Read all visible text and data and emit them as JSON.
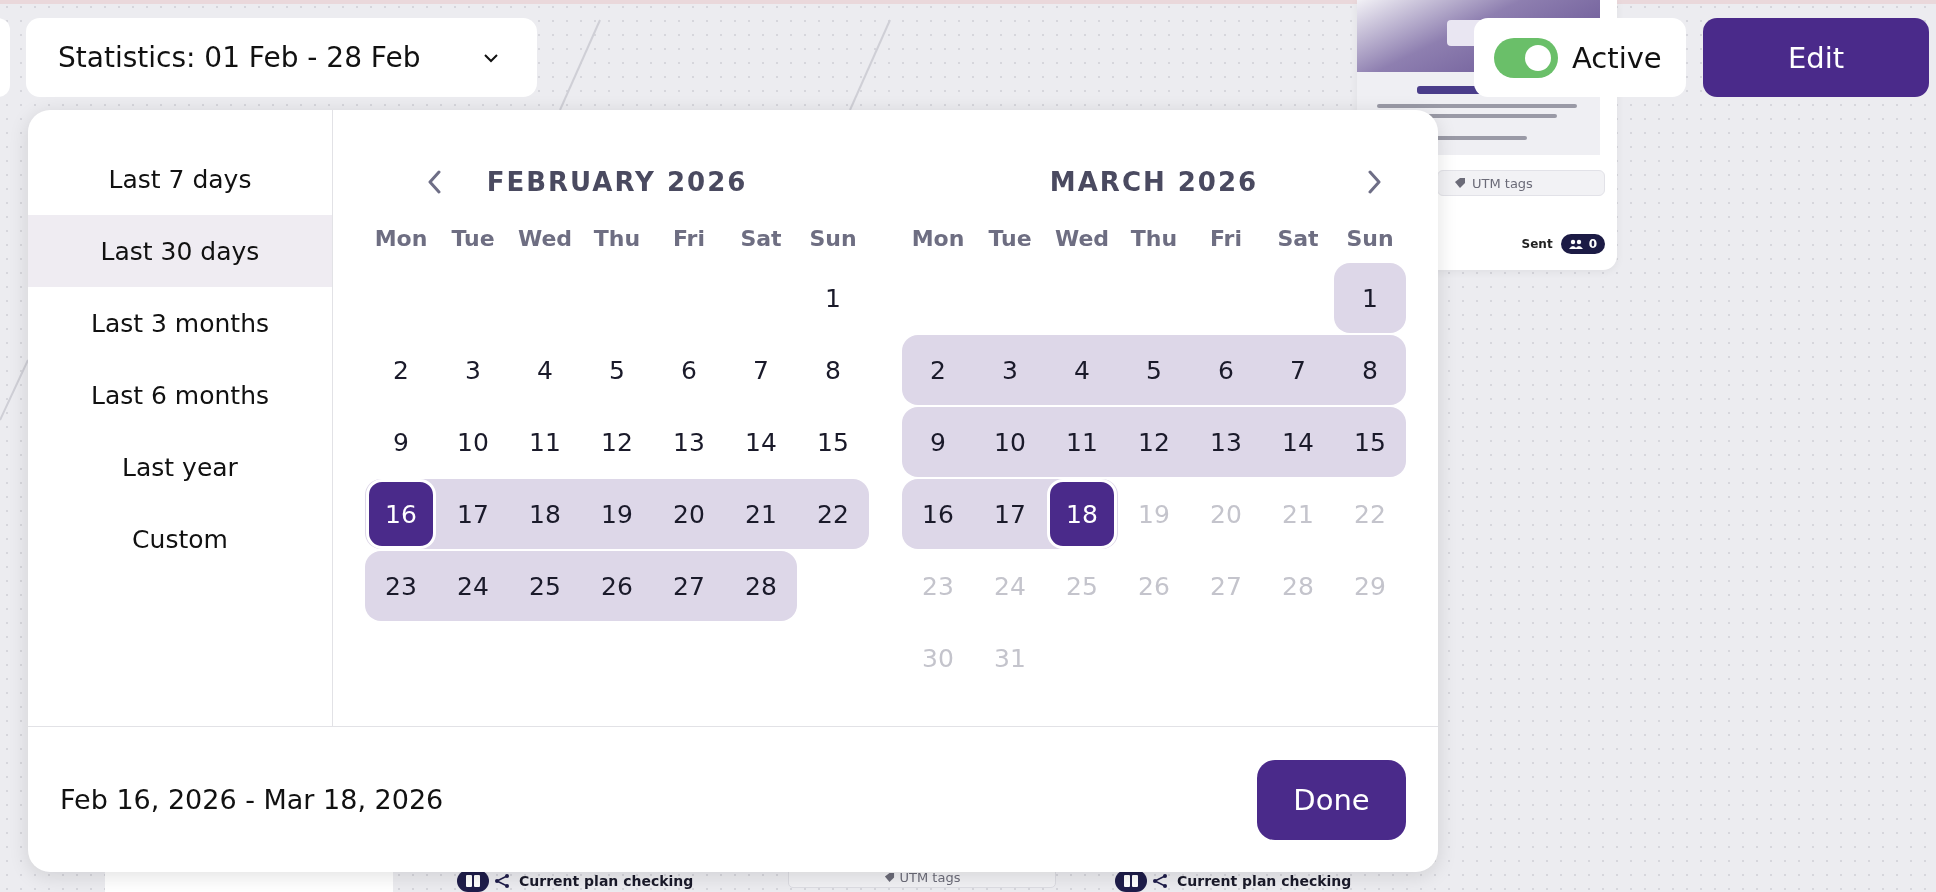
{
  "toolbar": {
    "statistics_button": "Statistics: 01 Feb - 28 Feb",
    "active_toggle": {
      "label": "Active",
      "on": true
    },
    "edit_button": "Edit"
  },
  "background_nodes": [
    {
      "kind": "email",
      "utm": "UTM tags",
      "sent_label": "Sent",
      "sent_count": "0"
    },
    {
      "kind": "action",
      "label": "Current plan checking"
    },
    {
      "kind": "utm",
      "label": "UTM tags"
    },
    {
      "kind": "action",
      "label": "Current plan checking"
    }
  ],
  "date_picker": {
    "presets": [
      {
        "label": "Last 7 days",
        "selected": false
      },
      {
        "label": "Last 30 days",
        "selected": true
      },
      {
        "label": "Last 3 months",
        "selected": false
      },
      {
        "label": "Last 6 months",
        "selected": false
      },
      {
        "label": "Last year",
        "selected": false
      },
      {
        "label": "Custom",
        "selected": false
      }
    ],
    "months": [
      {
        "title": "FEBRUARY 2026",
        "kind": "prev",
        "weekdays": [
          "Mon",
          "Tue",
          "Wed",
          "Thu",
          "Fri",
          "Sat",
          "Sun"
        ],
        "weeks": [
          [
            {
              "kind": "blank"
            },
            {
              "kind": "blank"
            },
            {
              "kind": "blank"
            },
            {
              "kind": "blank"
            },
            {
              "kind": "blank"
            },
            {
              "kind": "blank"
            },
            {
              "kind": "day",
              "label": "1",
              "in_range": false,
              "selected": false,
              "disabled": false
            }
          ],
          [
            {
              "kind": "day",
              "label": "2",
              "in_range": false,
              "selected": false,
              "disabled": false
            },
            {
              "kind": "day",
              "label": "3",
              "in_range": false,
              "selected": false,
              "disabled": false
            },
            {
              "kind": "day",
              "label": "4",
              "in_range": false,
              "selected": false,
              "disabled": false
            },
            {
              "kind": "day",
              "label": "5",
              "in_range": false,
              "selected": false,
              "disabled": false
            },
            {
              "kind": "day",
              "label": "6",
              "in_range": false,
              "selected": false,
              "disabled": false
            },
            {
              "kind": "day",
              "label": "7",
              "in_range": false,
              "selected": false,
              "disabled": false
            },
            {
              "kind": "day",
              "label": "8",
              "in_range": false,
              "selected": false,
              "disabled": false
            }
          ],
          [
            {
              "kind": "day",
              "label": "9",
              "in_range": false,
              "selected": false,
              "disabled": false
            },
            {
              "kind": "day",
              "label": "10",
              "in_range": false,
              "selected": false,
              "disabled": false
            },
            {
              "kind": "day",
              "label": "11",
              "in_range": false,
              "selected": false,
              "disabled": false
            },
            {
              "kind": "day",
              "label": "12",
              "in_range": false,
              "selected": false,
              "disabled": false
            },
            {
              "kind": "day",
              "label": "13",
              "in_range": false,
              "selected": false,
              "disabled": false
            },
            {
              "kind": "day",
              "label": "14",
              "in_range": false,
              "selected": false,
              "disabled": false
            },
            {
              "kind": "day",
              "label": "15",
              "in_range": false,
              "selected": false,
              "disabled": false
            }
          ],
          [
            {
              "kind": "day",
              "label": "16",
              "in_range": true,
              "selected": true,
              "disabled": false
            },
            {
              "kind": "day",
              "label": "17",
              "in_range": true,
              "selected": false,
              "disabled": false
            },
            {
              "kind": "day",
              "label": "18",
              "in_range": true,
              "selected": false,
              "disabled": false
            },
            {
              "kind": "day",
              "label": "19",
              "in_range": true,
              "selected": false,
              "disabled": false
            },
            {
              "kind": "day",
              "label": "20",
              "in_range": true,
              "selected": false,
              "disabled": false
            },
            {
              "kind": "day",
              "label": "21",
              "in_range": true,
              "selected": false,
              "disabled": false
            },
            {
              "kind": "day",
              "label": "22",
              "in_range": true,
              "selected": false,
              "disabled": false
            }
          ],
          [
            {
              "kind": "day",
              "label": "23",
              "in_range": true,
              "selected": false,
              "disabled": false
            },
            {
              "kind": "day",
              "label": "24",
              "in_range": true,
              "selected": false,
              "disabled": false
            },
            {
              "kind": "day",
              "label": "25",
              "in_range": true,
              "selected": false,
              "disabled": false
            },
            {
              "kind": "day",
              "label": "26",
              "in_range": true,
              "selected": false,
              "disabled": false
            },
            {
              "kind": "day",
              "label": "27",
              "in_range": true,
              "selected": false,
              "disabled": false
            },
            {
              "kind": "day",
              "label": "28",
              "in_range": true,
              "selected": false,
              "disabled": false
            }
          ]
        ]
      },
      {
        "title": "MARCH 2026",
        "kind": "next",
        "weekdays": [
          "Mon",
          "Tue",
          "Wed",
          "Thu",
          "Fri",
          "Sat",
          "Sun"
        ],
        "weeks": [
          [
            {
              "kind": "blank"
            },
            {
              "kind": "blank"
            },
            {
              "kind": "blank"
            },
            {
              "kind": "blank"
            },
            {
              "kind": "blank"
            },
            {
              "kind": "blank"
            },
            {
              "kind": "day",
              "label": "1",
              "in_range": true,
              "selected": false,
              "disabled": false
            }
          ],
          [
            {
              "kind": "day",
              "label": "2",
              "in_range": true,
              "selected": false,
              "disabled": false
            },
            {
              "kind": "day",
              "label": "3",
              "in_range": true,
              "selected": false,
              "disabled": false
            },
            {
              "kind": "day",
              "label": "4",
              "in_range": true,
              "selected": false,
              "disabled": false
            },
            {
              "kind": "day",
              "label": "5",
              "in_range": true,
              "selected": false,
              "disabled": false
            },
            {
              "kind": "day",
              "label": "6",
              "in_range": true,
              "selected": false,
              "disabled": false
            },
            {
              "kind": "day",
              "label": "7",
              "in_range": true,
              "selected": false,
              "disabled": false
            },
            {
              "kind": "day",
              "label": "8",
              "in_range": true,
              "selected": false,
              "disabled": false
            }
          ],
          [
            {
              "kind": "day",
              "label": "9",
              "in_range": true,
              "selected": false,
              "disabled": false
            },
            {
              "kind": "day",
              "label": "10",
              "in_range": true,
              "selected": false,
              "disabled": false
            },
            {
              "kind": "day",
              "label": "11",
              "in_range": true,
              "selected": false,
              "disabled": false
            },
            {
              "kind": "day",
              "label": "12",
              "in_range": true,
              "selected": false,
              "disabled": false
            },
            {
              "kind": "day",
              "label": "13",
              "in_range": true,
              "selected": false,
              "disabled": false
            },
            {
              "kind": "day",
              "label": "14",
              "in_range": true,
              "selected": false,
              "disabled": false
            },
            {
              "kind": "day",
              "label": "15",
              "in_range": true,
              "selected": false,
              "disabled": false
            }
          ],
          [
            {
              "kind": "day",
              "label": "16",
              "in_range": true,
              "selected": false,
              "disabled": false
            },
            {
              "kind": "day",
              "label": "17",
              "in_range": true,
              "selected": false,
              "disabled": false
            },
            {
              "kind": "day",
              "label": "18",
              "in_range": true,
              "selected": true,
              "disabled": false
            },
            {
              "kind": "day",
              "label": "19",
              "in_range": false,
              "selected": false,
              "disabled": true
            },
            {
              "kind": "day",
              "label": "20",
              "in_range": false,
              "selected": false,
              "disabled": true
            },
            {
              "kind": "day",
              "label": "21",
              "in_range": false,
              "selected": false,
              "disabled": true
            },
            {
              "kind": "day",
              "label": "22",
              "in_range": false,
              "selected": false,
              "disabled": true
            }
          ],
          [
            {
              "kind": "day",
              "label": "23",
              "in_range": false,
              "selected": false,
              "disabled": true
            },
            {
              "kind": "day",
              "label": "24",
              "in_range": false,
              "selected": false,
              "disabled": true
            },
            {
              "kind": "day",
              "label": "25",
              "in_range": false,
              "selected": false,
              "disabled": true
            },
            {
              "kind": "day",
              "label": "26",
              "in_range": false,
              "selected": false,
              "disabled": true
            },
            {
              "kind": "day",
              "label": "27",
              "in_range": false,
              "selected": false,
              "disabled": true
            },
            {
              "kind": "day",
              "label": "28",
              "in_range": false,
              "selected": false,
              "disabled": true
            },
            {
              "kind": "day",
              "label": "29",
              "in_range": false,
              "selected": false,
              "disabled": true
            }
          ],
          [
            {
              "kind": "day",
              "label": "30",
              "in_range": false,
              "selected": false,
              "disabled": true
            },
            {
              "kind": "day",
              "label": "31",
              "in_range": false,
              "selected": false,
              "disabled": true
            }
          ]
        ]
      }
    ],
    "range_text": "Feb 16, 2026 - Mar 18, 2026",
    "done_button": "Done"
  }
}
